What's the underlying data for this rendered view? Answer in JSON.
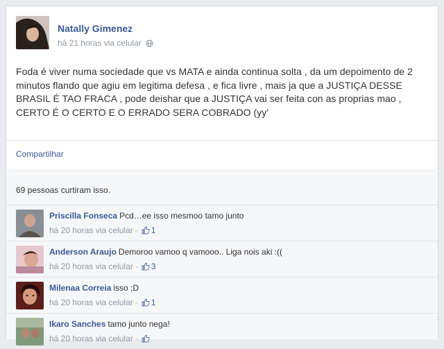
{
  "post": {
    "author": "Natally Gimenez",
    "meta": "há 21 horas via celular",
    "text": "Foda é viver numa sociedade que vs MATA e ainda continua solta , da um depoimento de 2 minutos flando que agiu em legitima defesa , e fica livre , mais ja que a JUSTIÇA DESSE BRASIL É TAO FRACA , pode deishar que a JUSTIÇA vai ser feita con as proprias mao , CERTO É O CERTO E O ERRADO SERA COBRADO (yy'"
  },
  "actions": {
    "share": "Compartilhar"
  },
  "likes": {
    "summary": "69 pessoas curtiram isso."
  },
  "comments": [
    {
      "name": "Priscilla Fonseca",
      "text": "Pcd…ee isso mesmoo tamo junto",
      "meta": "há 20 horas via celular",
      "likes": "1"
    },
    {
      "name": "Anderson Araujo",
      "text": "Demoroo vamoo q vamooo.. Liga nois aki :((",
      "meta": "há 20 horas via celular",
      "likes": "3"
    },
    {
      "name": "Milenaa Correia",
      "text": "isso ;D",
      "meta": "há 20 horas via celular",
      "likes": "1"
    },
    {
      "name": "Ikaro Sanches",
      "text": "tamo junto nega!",
      "meta": "há 20 horas via celular",
      "likes": ""
    }
  ],
  "colors": {
    "link": "#3b5998",
    "meta": "#9197a3",
    "background": "#e9ebee",
    "feedback_bg": "#f6f7f9"
  }
}
